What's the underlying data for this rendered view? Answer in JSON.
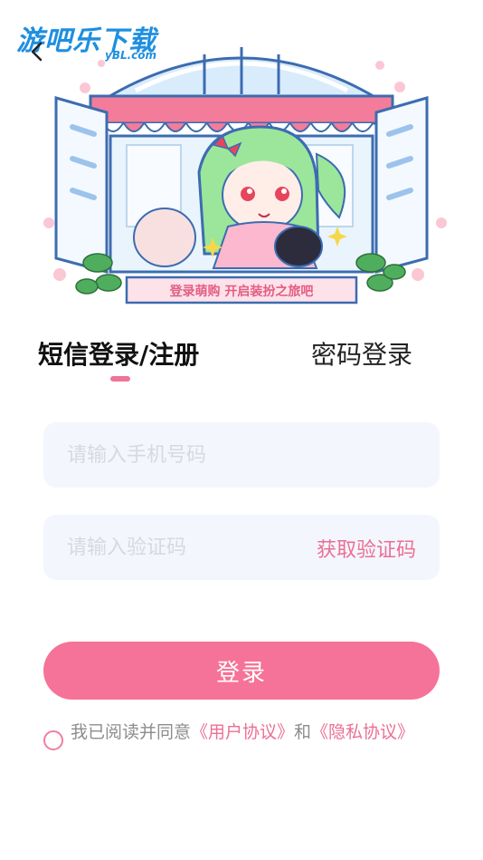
{
  "watermark": {
    "brand": "游吧乐下载",
    "domain": "yBL.com"
  },
  "hero": {
    "banner_text": "登录萌购   开启装扮之旅吧"
  },
  "tabs": {
    "sms_label": "短信登录/注册",
    "password_label": "密码登录"
  },
  "form": {
    "phone_placeholder": "请输入手机号码",
    "code_placeholder": "请输入验证码",
    "get_code_label": "获取验证码"
  },
  "login_button": {
    "label": "登录"
  },
  "agreement": {
    "prefix": "我已阅读并同意",
    "user_agreement": "《用户协议》",
    "and": "和",
    "privacy_policy": "《隐私协议》"
  },
  "colors": {
    "accent": "#f57398",
    "link": "#ec6f93",
    "input_bg": "#f3f6fd",
    "watermark": "#1e8fe0"
  },
  "icons": {
    "back": "back-chevron-icon",
    "radio": "radio-unchecked-icon"
  }
}
